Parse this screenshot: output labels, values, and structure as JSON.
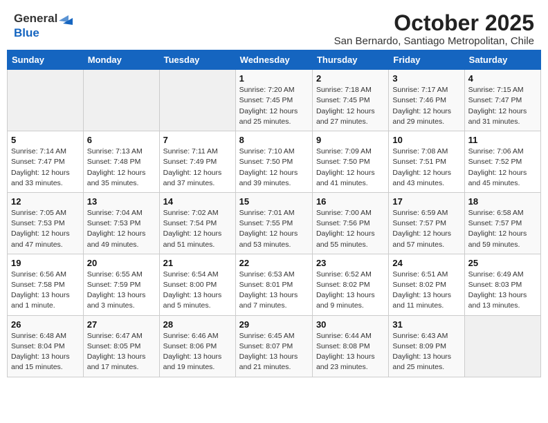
{
  "logo": {
    "text_general": "General",
    "text_blue": "Blue"
  },
  "header": {
    "month_title": "October 2025",
    "subtitle": "San Bernardo, Santiago Metropolitan, Chile"
  },
  "days_of_week": [
    "Sunday",
    "Monday",
    "Tuesday",
    "Wednesday",
    "Thursday",
    "Friday",
    "Saturday"
  ],
  "weeks": [
    {
      "days": [
        {
          "number": "",
          "info": ""
        },
        {
          "number": "",
          "info": ""
        },
        {
          "number": "",
          "info": ""
        },
        {
          "number": "1",
          "info": "Sunrise: 7:20 AM\nSunset: 7:45 PM\nDaylight: 12 hours\nand 25 minutes."
        },
        {
          "number": "2",
          "info": "Sunrise: 7:18 AM\nSunset: 7:45 PM\nDaylight: 12 hours\nand 27 minutes."
        },
        {
          "number": "3",
          "info": "Sunrise: 7:17 AM\nSunset: 7:46 PM\nDaylight: 12 hours\nand 29 minutes."
        },
        {
          "number": "4",
          "info": "Sunrise: 7:15 AM\nSunset: 7:47 PM\nDaylight: 12 hours\nand 31 minutes."
        }
      ]
    },
    {
      "days": [
        {
          "number": "5",
          "info": "Sunrise: 7:14 AM\nSunset: 7:47 PM\nDaylight: 12 hours\nand 33 minutes."
        },
        {
          "number": "6",
          "info": "Sunrise: 7:13 AM\nSunset: 7:48 PM\nDaylight: 12 hours\nand 35 minutes."
        },
        {
          "number": "7",
          "info": "Sunrise: 7:11 AM\nSunset: 7:49 PM\nDaylight: 12 hours\nand 37 minutes."
        },
        {
          "number": "8",
          "info": "Sunrise: 7:10 AM\nSunset: 7:50 PM\nDaylight: 12 hours\nand 39 minutes."
        },
        {
          "number": "9",
          "info": "Sunrise: 7:09 AM\nSunset: 7:50 PM\nDaylight: 12 hours\nand 41 minutes."
        },
        {
          "number": "10",
          "info": "Sunrise: 7:08 AM\nSunset: 7:51 PM\nDaylight: 12 hours\nand 43 minutes."
        },
        {
          "number": "11",
          "info": "Sunrise: 7:06 AM\nSunset: 7:52 PM\nDaylight: 12 hours\nand 45 minutes."
        }
      ]
    },
    {
      "days": [
        {
          "number": "12",
          "info": "Sunrise: 7:05 AM\nSunset: 7:53 PM\nDaylight: 12 hours\nand 47 minutes."
        },
        {
          "number": "13",
          "info": "Sunrise: 7:04 AM\nSunset: 7:53 PM\nDaylight: 12 hours\nand 49 minutes."
        },
        {
          "number": "14",
          "info": "Sunrise: 7:02 AM\nSunset: 7:54 PM\nDaylight: 12 hours\nand 51 minutes."
        },
        {
          "number": "15",
          "info": "Sunrise: 7:01 AM\nSunset: 7:55 PM\nDaylight: 12 hours\nand 53 minutes."
        },
        {
          "number": "16",
          "info": "Sunrise: 7:00 AM\nSunset: 7:56 PM\nDaylight: 12 hours\nand 55 minutes."
        },
        {
          "number": "17",
          "info": "Sunrise: 6:59 AM\nSunset: 7:57 PM\nDaylight: 12 hours\nand 57 minutes."
        },
        {
          "number": "18",
          "info": "Sunrise: 6:58 AM\nSunset: 7:57 PM\nDaylight: 12 hours\nand 59 minutes."
        }
      ]
    },
    {
      "days": [
        {
          "number": "19",
          "info": "Sunrise: 6:56 AM\nSunset: 7:58 PM\nDaylight: 13 hours\nand 1 minute."
        },
        {
          "number": "20",
          "info": "Sunrise: 6:55 AM\nSunset: 7:59 PM\nDaylight: 13 hours\nand 3 minutes."
        },
        {
          "number": "21",
          "info": "Sunrise: 6:54 AM\nSunset: 8:00 PM\nDaylight: 13 hours\nand 5 minutes."
        },
        {
          "number": "22",
          "info": "Sunrise: 6:53 AM\nSunset: 8:01 PM\nDaylight: 13 hours\nand 7 minutes."
        },
        {
          "number": "23",
          "info": "Sunrise: 6:52 AM\nSunset: 8:02 PM\nDaylight: 13 hours\nand 9 minutes."
        },
        {
          "number": "24",
          "info": "Sunrise: 6:51 AM\nSunset: 8:02 PM\nDaylight: 13 hours\nand 11 minutes."
        },
        {
          "number": "25",
          "info": "Sunrise: 6:49 AM\nSunset: 8:03 PM\nDaylight: 13 hours\nand 13 minutes."
        }
      ]
    },
    {
      "days": [
        {
          "number": "26",
          "info": "Sunrise: 6:48 AM\nSunset: 8:04 PM\nDaylight: 13 hours\nand 15 minutes."
        },
        {
          "number": "27",
          "info": "Sunrise: 6:47 AM\nSunset: 8:05 PM\nDaylight: 13 hours\nand 17 minutes."
        },
        {
          "number": "28",
          "info": "Sunrise: 6:46 AM\nSunset: 8:06 PM\nDaylight: 13 hours\nand 19 minutes."
        },
        {
          "number": "29",
          "info": "Sunrise: 6:45 AM\nSunset: 8:07 PM\nDaylight: 13 hours\nand 21 minutes."
        },
        {
          "number": "30",
          "info": "Sunrise: 6:44 AM\nSunset: 8:08 PM\nDaylight: 13 hours\nand 23 minutes."
        },
        {
          "number": "31",
          "info": "Sunrise: 6:43 AM\nSunset: 8:09 PM\nDaylight: 13 hours\nand 25 minutes."
        },
        {
          "number": "",
          "info": ""
        }
      ]
    }
  ]
}
